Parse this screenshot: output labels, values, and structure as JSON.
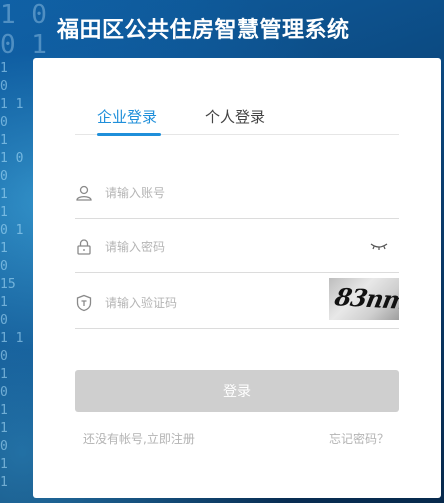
{
  "app_title": "福田区公共住房智慧管理系统",
  "tabs": [
    {
      "label": "企业登录",
      "active": true
    },
    {
      "label": "个人登录",
      "active": false
    }
  ],
  "fields": {
    "account": {
      "placeholder": "请输入账号",
      "value": "",
      "icon": "user-icon"
    },
    "password": {
      "placeholder": "请输入密码",
      "value": "",
      "icon": "lock-icon",
      "toggle_icon": "eye-closed-icon"
    },
    "captcha": {
      "placeholder": "请输入验证码",
      "value": "",
      "icon": "shield-icon",
      "captcha_image_text": "83nm"
    }
  },
  "login_button_label": "登录",
  "register_link": "还没有帐号,立即注册",
  "forgot_link": "忘记密码？",
  "colors": {
    "accent": "#1f8fda",
    "button_disabled": "#cfcfcf",
    "background": "#0b3f6e"
  }
}
